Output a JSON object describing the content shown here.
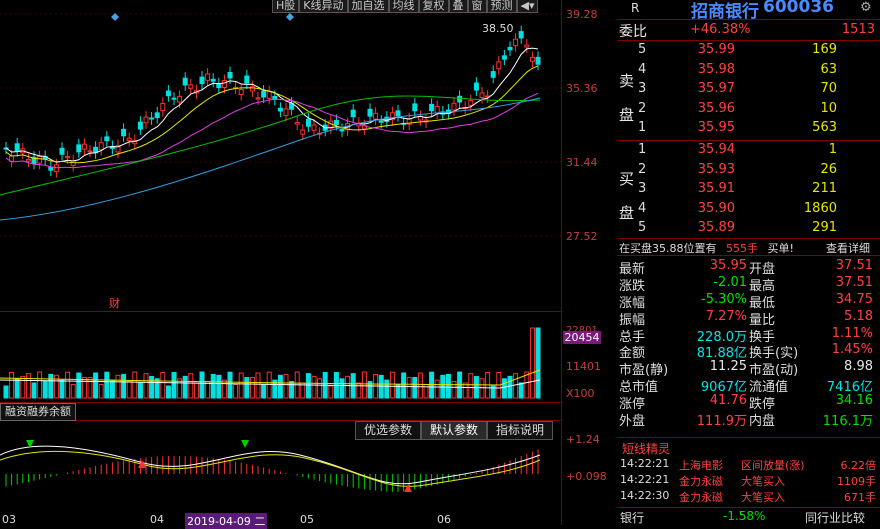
{
  "toolbar": [
    "H股",
    "K线异动",
    "加自选",
    "均线",
    "复权",
    "叠",
    "窗",
    "预测"
  ],
  "price_axis": [
    "39.28",
    "35.36",
    "31.44",
    "27.52"
  ],
  "high_label": "38.50",
  "fin_label": "财",
  "volume_axis": {
    "top": "22801",
    "highlight": "20454",
    "mid": "11401",
    "unit": "X100"
  },
  "indicator_name": "融资融券余额",
  "param_tabs": [
    "优选参数",
    "默认参数",
    "指标说明"
  ],
  "macd_axis": {
    "top": "+1.24",
    "mid": "+0.098"
  },
  "date_labels": [
    "03",
    "04",
    "2019-04-09 二",
    "05",
    "06"
  ],
  "quote": {
    "R": "R",
    "name": "招商银行",
    "code": "600036",
    "committee_label": "委比",
    "committee_ratio": "+46.38%",
    "committee_diff": "1513",
    "sell_label": "卖盘",
    "buy_label": "买盘",
    "sell": [
      {
        "lvl": "5",
        "price": "35.99",
        "vol": "169"
      },
      {
        "lvl": "4",
        "price": "35.98",
        "vol": "63"
      },
      {
        "lvl": "3",
        "price": "35.97",
        "vol": "70"
      },
      {
        "lvl": "2",
        "price": "35.96",
        "vol": "10"
      },
      {
        "lvl": "1",
        "price": "35.95",
        "vol": "563"
      }
    ],
    "buy": [
      {
        "lvl": "1",
        "price": "35.94",
        "vol": "1"
      },
      {
        "lvl": "2",
        "price": "35.93",
        "vol": "26"
      },
      {
        "lvl": "3",
        "price": "35.91",
        "vol": "211"
      },
      {
        "lvl": "4",
        "price": "35.90",
        "vol": "1860"
      },
      {
        "lvl": "5",
        "price": "35.89",
        "vol": "291"
      }
    ],
    "info_line": {
      "text": "在买盘35.88位置有",
      "num": "555手",
      "tag": "买单!",
      "detail": "查看详细"
    },
    "stats": [
      {
        "l1": "最新",
        "v1": "35.95",
        "l2": "开盘",
        "v2": "37.51"
      },
      {
        "l1": "涨跌",
        "v1": "-2.01",
        "l2": "最高",
        "v2": "37.51"
      },
      {
        "l1": "涨幅",
        "v1": "-5.30%",
        "l2": "最低",
        "v2": "34.75"
      },
      {
        "l1": "振幅",
        "v1": "7.27%",
        "l2": "量比",
        "v2": "5.18"
      },
      {
        "l1": "总手",
        "v1": "228.0万",
        "l2": "换手",
        "v2": "1.11%"
      },
      {
        "l1": "金额",
        "v1": "81.88亿",
        "l2": "换手(实)",
        "v2": "1.45%"
      },
      {
        "l1": "市盈(静)",
        "v1": "11.25",
        "l2": "市盈(动)",
        "v2": "8.98"
      },
      {
        "l1": "总市值",
        "v1": "9067亿",
        "l2": "流通值",
        "v2": "7416亿"
      },
      {
        "l1": "涨停",
        "v1": "41.76",
        "l2": "跌停",
        "v2": "34.16"
      },
      {
        "l1": "外盘",
        "v1": "111.9万",
        "l2": "内盘",
        "v2": "116.1万"
      }
    ]
  },
  "sprite": {
    "title": "短线精灵",
    "rows": [
      {
        "time": "14:22:21",
        "name": "上海电影",
        "event": "区间放量(涨)",
        "val": "6.22倍"
      },
      {
        "time": "14:22:21",
        "name": "金力永磁",
        "event": "大笔买入",
        "val": "1109手"
      },
      {
        "time": "14:22:30",
        "name": "金力永磁",
        "event": "大笔买入",
        "val": "671手"
      }
    ]
  },
  "bottom_bar": {
    "sector": "银行",
    "change": "-1.58%",
    "compare": "同行业比较"
  }
}
